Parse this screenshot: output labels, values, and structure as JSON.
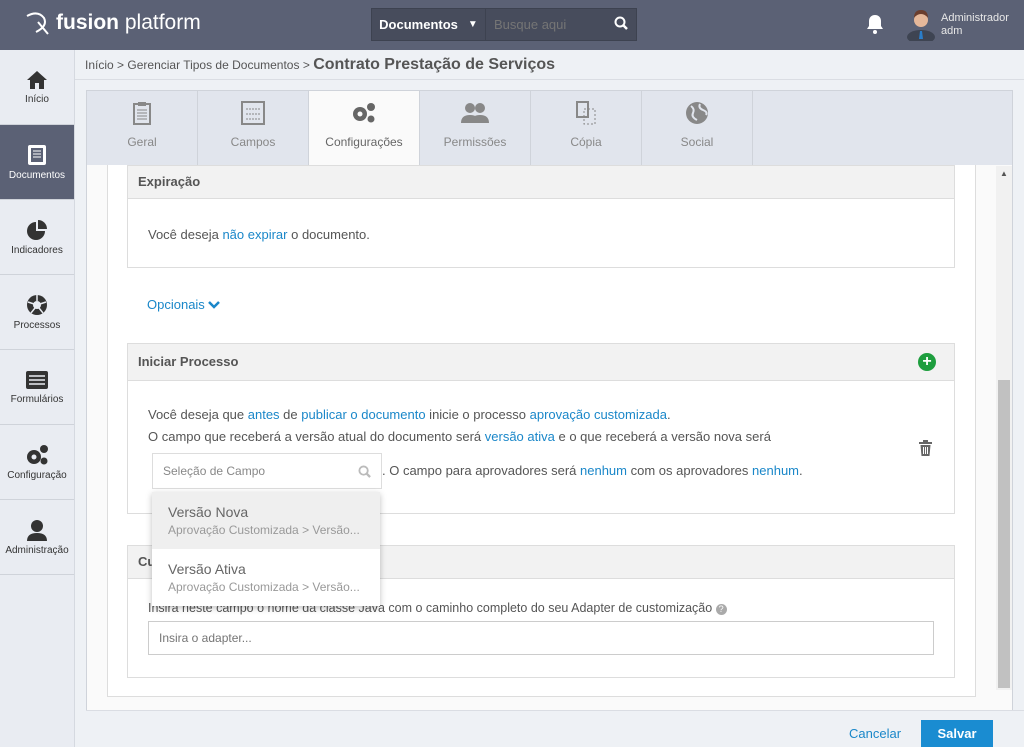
{
  "header": {
    "brand_bold": "fusion",
    "brand_light": "platform",
    "search_scope": "Documentos",
    "search_placeholder": "Busque aqui",
    "user_name": "Administrador",
    "user_login": "adm"
  },
  "sidebar": {
    "items": [
      {
        "label": "Início",
        "icon": "home-icon"
      },
      {
        "label": "Documentos",
        "icon": "document-icon",
        "active": true
      },
      {
        "label": "Indicadores",
        "icon": "pie-chart-icon"
      },
      {
        "label": "Processos",
        "icon": "aperture-icon"
      },
      {
        "label": "Formulários",
        "icon": "form-icon"
      },
      {
        "label": "Configuração",
        "icon": "gears-icon"
      },
      {
        "label": "Administração",
        "icon": "user-icon"
      }
    ]
  },
  "breadcrumb": {
    "items": [
      "Início",
      ">",
      "Gerenciar Tipos de Documentos",
      ">"
    ],
    "title": "Contrato Prestação de Serviços"
  },
  "tabs": [
    {
      "label": "Geral"
    },
    {
      "label": "Campos"
    },
    {
      "label": "Configurações",
      "active": true
    },
    {
      "label": "Permissões"
    },
    {
      "label": "Cópia"
    },
    {
      "label": "Social"
    }
  ],
  "expiracao": {
    "title": "Expiração",
    "t1": "Você deseja ",
    "l1": "não expirar",
    "t2": " o documento."
  },
  "opcionais": "Opcionais",
  "processo": {
    "title": "Iniciar Processo",
    "s1": [
      "Você deseja que ",
      "antes",
      " de ",
      "publicar o documento",
      " inicie o processo ",
      "aprovação customizada",
      "."
    ],
    "s2": [
      "O campo que receberá a versão atual do documento será ",
      "versão ativa",
      " e o que receberá a versão nova será"
    ],
    "field_placeholder": "Seleção de Campo",
    "s3": [
      ". O campo para aprovadores será ",
      "nenhum",
      " com os aprovadores ",
      "nenhum",
      "."
    ]
  },
  "dropdown": [
    {
      "label": "Versão Nova",
      "path": "Aprovação Customizada > Versão..."
    },
    {
      "label": "Versão Ativa",
      "path": "Aprovação Customizada > Versão..."
    }
  ],
  "custom": {
    "title_visible": "Cu",
    "hint": "Insira neste campo o nome da classe Java com o caminho completo do seu Adapter de customização",
    "placeholder": "Insira o adapter..."
  },
  "footer": {
    "cancel": "Cancelar",
    "save": "Salvar"
  },
  "colors": {
    "header": "#5b6175",
    "link": "#1a87c9",
    "save": "#1a8cd1",
    "add": "#1e9e3e"
  }
}
